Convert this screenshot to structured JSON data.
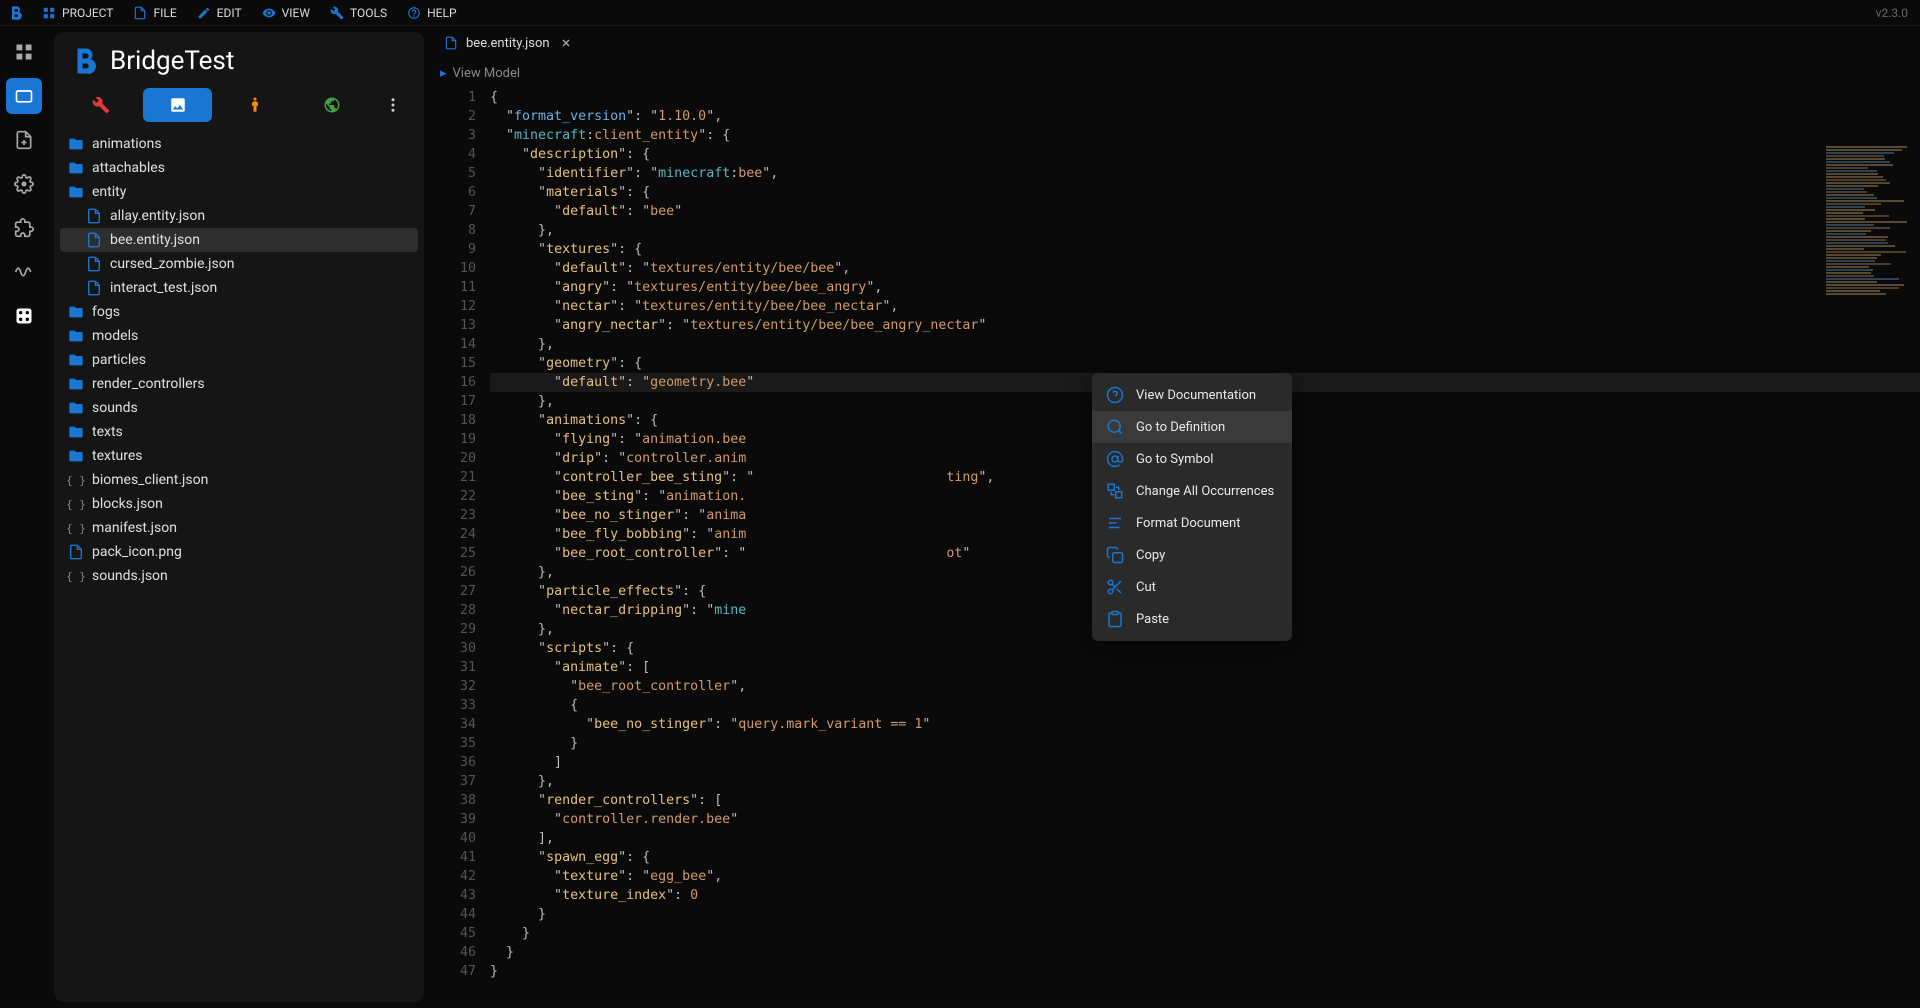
{
  "version_label": "v2.3.0",
  "topbar": {
    "project": "PROJECT",
    "file": "FILE",
    "edit": "EDIT",
    "view": "VIEW",
    "tools": "TOOLS",
    "help": "HELP"
  },
  "project_name": "BridgeTest",
  "rail": [
    {
      "name": "apps-icon",
      "active": false
    },
    {
      "name": "folder-icon",
      "active": true
    },
    {
      "name": "file-add-icon",
      "active": false
    },
    {
      "name": "settings-build-icon",
      "active": false
    },
    {
      "name": "extension-icon",
      "active": false
    },
    {
      "name": "waveform-icon",
      "active": false
    },
    {
      "name": "dice-icon",
      "active": false
    }
  ],
  "tree": [
    {
      "type": "folder",
      "label": "animations"
    },
    {
      "type": "folder",
      "label": "attachables"
    },
    {
      "type": "folder",
      "label": "entity",
      "expanded": true,
      "children": [
        {
          "type": "file",
          "label": "allay.entity.json"
        },
        {
          "type": "file",
          "label": "bee.entity.json",
          "selected": true
        },
        {
          "type": "file",
          "label": "cursed_zombie.json"
        },
        {
          "type": "file",
          "label": "interact_test.json"
        }
      ]
    },
    {
      "type": "folder",
      "label": "fogs"
    },
    {
      "type": "folder",
      "label": "models"
    },
    {
      "type": "folder",
      "label": "particles"
    },
    {
      "type": "folder",
      "label": "render_controllers"
    },
    {
      "type": "folder",
      "label": "sounds"
    },
    {
      "type": "folder",
      "label": "texts"
    },
    {
      "type": "folder",
      "label": "textures"
    },
    {
      "type": "json",
      "label": "biomes_client.json"
    },
    {
      "type": "json",
      "label": "blocks.json"
    },
    {
      "type": "json",
      "label": "manifest.json"
    },
    {
      "type": "file",
      "label": "pack_icon.png"
    },
    {
      "type": "json",
      "label": "sounds.json"
    }
  ],
  "open_tab": {
    "label": "bee.entity.json"
  },
  "breadcrumb": "View Model",
  "highlighted_line": 16,
  "code_lines": [
    {
      "n": 1,
      "html": "<span class='punc'>{</span>"
    },
    {
      "n": 2,
      "html": "  <span class='punc'>\"</span><span class='tok-key'>format_version</span><span class='punc'>\":</span> <span class='punc'>\"</span><span class='tok-str'>1.10.0</span><span class='punc'>\",</span>"
    },
    {
      "n": 3,
      "html": "  <span class='punc'>\"</span><span class='tok-pref'>minecraft</span><span class='punc'>:</span><span class='tok-suf'>client_entity</span><span class='punc'>\":</span> <span class='punc'>{</span>"
    },
    {
      "n": 4,
      "html": "    <span class='punc'>\"</span><span class='tok-yellow'>description</span><span class='punc'>\":</span> <span class='punc'>{</span>"
    },
    {
      "n": 5,
      "html": "      <span class='punc'>\"</span><span class='tok-yellow'>identifier</span><span class='punc'>\":</span> <span class='punc'>\"</span><span class='tok-pref'>minecraft</span><span class='punc'>:</span><span class='tok-suf'>bee</span><span class='punc'>\",</span>"
    },
    {
      "n": 6,
      "html": "      <span class='punc'>\"</span><span class='tok-yellow'>materials</span><span class='punc'>\":</span> <span class='punc'>{</span>"
    },
    {
      "n": 7,
      "html": "        <span class='punc'>\"</span><span class='tok-yellow'>default</span><span class='punc'>\":</span> <span class='punc'>\"</span><span class='tok-str'>bee</span><span class='punc'>\"</span>"
    },
    {
      "n": 8,
      "html": "      <span class='punc'>},</span>"
    },
    {
      "n": 9,
      "html": "      <span class='punc'>\"</span><span class='tok-yellow'>textures</span><span class='punc'>\":</span> <span class='punc'>{</span>"
    },
    {
      "n": 10,
      "html": "        <span class='punc'>\"</span><span class='tok-yellow'>default</span><span class='punc'>\":</span> <span class='punc'>\"</span><span class='tok-str'>textures/entity/bee/bee</span><span class='punc'>\",</span>"
    },
    {
      "n": 11,
      "html": "        <span class='punc'>\"</span><span class='tok-yellow'>angry</span><span class='punc'>\":</span> <span class='punc'>\"</span><span class='tok-str'>textures/entity/bee/bee_angry</span><span class='punc'>\",</span>"
    },
    {
      "n": 12,
      "html": "        <span class='punc'>\"</span><span class='tok-yellow'>nectar</span><span class='punc'>\":</span> <span class='punc'>\"</span><span class='tok-str'>textures/entity/bee/bee_nectar</span><span class='punc'>\",</span>"
    },
    {
      "n": 13,
      "html": "        <span class='punc'>\"</span><span class='tok-yellow'>angry_nectar</span><span class='punc'>\":</span> <span class='punc'>\"</span><span class='tok-str'>textures/entity/bee/bee_angry_nectar</span><span class='punc'>\"</span>"
    },
    {
      "n": 14,
      "html": "      <span class='punc'>},</span>"
    },
    {
      "n": 15,
      "html": "      <span class='punc'>\"</span><span class='tok-yellow'>geometry</span><span class='punc'>\":</span> <span class='punc'>{</span>"
    },
    {
      "n": 16,
      "html": "        <span class='punc'>\"</span><span class='tok-yellow'>default</span><span class='punc'>\":</span> <span class='punc'>\"</span><span class='tok-str'>geometry.bee</span><span class='punc'>\"</span>"
    },
    {
      "n": 17,
      "html": "      <span class='punc'>},</span>"
    },
    {
      "n": 18,
      "html": "      <span class='punc'>\"</span><span class='tok-yellow'>animations</span><span class='punc'>\":</span> <span class='punc'>{</span>"
    },
    {
      "n": 19,
      "html": "        <span class='punc'>\"</span><span class='tok-yellow'>flying</span><span class='punc'>\":</span> <span class='punc'>\"</span><span class='tok-str'>animation.bee</span>"
    },
    {
      "n": 20,
      "html": "        <span class='punc'>\"</span><span class='tok-yellow'>drip</span><span class='punc'>\":</span> <span class='punc'>\"</span><span class='tok-str'>controller.anim</span>"
    },
    {
      "n": 21,
      "html": "        <span class='punc'>\"</span><span class='tok-yellow'>controller_bee_sting</span><span class='punc'>\":</span> <span class='punc'>\"</span>                        <span class='tok-str'>ting</span><span class='punc'>\",</span>"
    },
    {
      "n": 22,
      "html": "        <span class='punc'>\"</span><span class='tok-yellow'>bee_sting</span><span class='punc'>\":</span> <span class='punc'>\"</span><span class='tok-str'>animation.</span>"
    },
    {
      "n": 23,
      "html": "        <span class='punc'>\"</span><span class='tok-yellow'>bee_no_stinger</span><span class='punc'>\":</span> <span class='punc'>\"</span><span class='tok-str'>anima</span>"
    },
    {
      "n": 24,
      "html": "        <span class='punc'>\"</span><span class='tok-yellow'>bee_fly_bobbing</span><span class='punc'>\":</span> <span class='punc'>\"</span><span class='tok-str'>anim</span>"
    },
    {
      "n": 25,
      "html": "        <span class='punc'>\"</span><span class='tok-yellow'>bee_root_controller</span><span class='punc'>\":</span> <span class='punc'>\"</span>                         <span class='tok-str'>ot</span><span class='punc'>\"</span>"
    },
    {
      "n": 26,
      "html": "      <span class='punc'>},</span>"
    },
    {
      "n": 27,
      "html": "      <span class='punc'>\"</span><span class='tok-yellow'>particle_effects</span><span class='punc'>\":</span> <span class='punc'>{</span>"
    },
    {
      "n": 28,
      "html": "        <span class='punc'>\"</span><span class='tok-yellow'>nectar_dripping</span><span class='punc'>\":</span> <span class='punc'>\"</span><span class='tok-pref'>mine</span>"
    },
    {
      "n": 29,
      "html": "      <span class='punc'>},</span>"
    },
    {
      "n": 30,
      "html": "      <span class='punc'>\"</span><span class='tok-yellow'>scripts</span><span class='punc'>\":</span> <span class='punc'>{</span>"
    },
    {
      "n": 31,
      "html": "        <span class='punc'>\"</span><span class='tok-yellow'>animate</span><span class='punc'>\":</span> <span class='punc'>[</span>"
    },
    {
      "n": 32,
      "html": "          <span class='punc'>\"</span><span class='tok-str'>bee_root_controller</span><span class='punc'>\",</span>"
    },
    {
      "n": 33,
      "html": "          <span class='punc'>{</span>"
    },
    {
      "n": 34,
      "html": "            <span class='punc'>\"</span><span class='tok-yellow'>bee_no_stinger</span><span class='punc'>\":</span> <span class='punc'>\"</span><span class='tok-str'>query.mark_variant == 1</span><span class='punc'>\"</span>"
    },
    {
      "n": 35,
      "html": "          <span class='punc'>}</span>"
    },
    {
      "n": 36,
      "html": "        <span class='punc'>]</span>"
    },
    {
      "n": 37,
      "html": "      <span class='punc'>},</span>"
    },
    {
      "n": 38,
      "html": "      <span class='punc'>\"</span><span class='tok-yellow'>render_controllers</span><span class='punc'>\":</span> <span class='punc'>[</span>"
    },
    {
      "n": 39,
      "html": "        <span class='punc'>\"</span><span class='tok-str'>controller.render.bee</span><span class='punc'>\"</span>"
    },
    {
      "n": 40,
      "html": "      <span class='punc'>],</span>"
    },
    {
      "n": 41,
      "html": "      <span class='punc'>\"</span><span class='tok-yellow'>spawn_egg</span><span class='punc'>\":</span> <span class='punc'>{</span>"
    },
    {
      "n": 42,
      "html": "        <span class='punc'>\"</span><span class='tok-yellow'>texture</span><span class='punc'>\":</span> <span class='punc'>\"</span><span class='tok-str'>egg_bee</span><span class='punc'>\",</span>"
    },
    {
      "n": 43,
      "html": "        <span class='punc'>\"</span><span class='tok-yellow'>texture_index</span><span class='punc'>\":</span> <span class='tok-num'>0</span>"
    },
    {
      "n": 44,
      "html": "      <span class='punc'>}</span>"
    },
    {
      "n": 45,
      "html": "    <span class='punc'>}</span>"
    },
    {
      "n": 46,
      "html": "  <span class='punc'>}</span>"
    },
    {
      "n": 47,
      "html": "<span class='punc'>}</span>"
    }
  ],
  "context_menu": [
    {
      "icon": "help-circle-icon",
      "label": "View Documentation"
    },
    {
      "icon": "search-icon",
      "label": "Go to Definition",
      "hover": true
    },
    {
      "icon": "at-icon",
      "label": "Go to Symbol"
    },
    {
      "icon": "replace-icon",
      "label": "Change All Occurrences"
    },
    {
      "icon": "format-icon",
      "label": "Format Document"
    },
    {
      "icon": "copy-icon",
      "label": "Copy"
    },
    {
      "icon": "cut-icon",
      "label": "Cut"
    },
    {
      "icon": "paste-icon",
      "label": "Paste"
    }
  ]
}
